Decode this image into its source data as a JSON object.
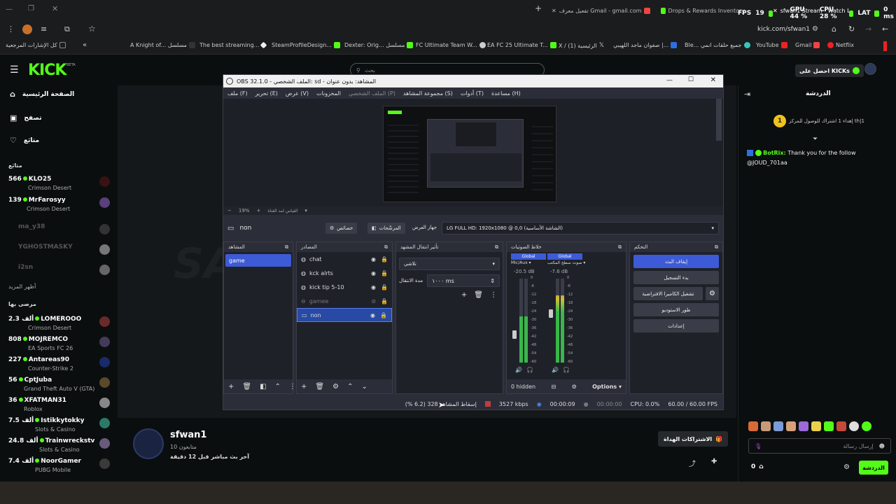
{
  "browser": {
    "tabs": [
      {
        "label": "تفعيل معرف Gmail - gmail.com"
      },
      {
        "label": "Drops & Rewards Inventory"
      },
      {
        "label": "sfwan1 Stream - Watch Live"
      }
    ],
    "overlay": {
      "fps_label": "FPS",
      "fps_value": "19",
      "gpu": "GPU 44 %",
      "cpu": "CPU 28 %",
      "lat": "LAT",
      "ms": "0 ms"
    },
    "url": "kick.com/sfwan1",
    "bookmarks": [
      {
        "label": "كل الإشارات المرجعية",
        "color": "#888"
      },
      {
        "label": "A Knight of... مسلسل",
        "color": "#333"
      },
      {
        "label": "The best streaming...",
        "color": "#fff"
      },
      {
        "label": "SteamProfileDesign...",
        "color": "#53fc18"
      },
      {
        "label": "Dexter: Orig... مسلسل",
        "color": "#53fc18"
      },
      {
        "label": "FC Ultimate Team W...",
        "color": "#ccc"
      },
      {
        "label": "EA FC 25 Ultimate T...",
        "color": "#53fc18"
      },
      {
        "label": "X / الرئيسية (1)",
        "color": "#fff"
      },
      {
        "label": "صفوان ماجد اللهيبي |...",
        "color": "#2d6fe0"
      },
      {
        "label": "Ble... جميع حلقات انمي",
        "color": "#39c5b8"
      },
      {
        "label": "YouTube",
        "color": "#e22"
      },
      {
        "label": "Gmail",
        "color": "#e44"
      },
      {
        "label": "Netflix",
        "color": "#e22"
      }
    ]
  },
  "kick": {
    "logo": "KICK",
    "beta": "BETA",
    "search_placeholder": "بحث",
    "get_kicks": "احصل على KICKs",
    "nav": [
      {
        "label": "الصفحة الرئيسية"
      },
      {
        "label": "تصفح"
      },
      {
        "label": "متابَع"
      }
    ],
    "following_heading": "متابَع",
    "following": [
      {
        "count": "566",
        "name": "KLO25",
        "game": "Crimson Desert",
        "live": true
      },
      {
        "count": "139",
        "name": "MrFarosyy",
        "game": "Crimson Desert",
        "live": true
      },
      {
        "count": "",
        "name": "ma_y38",
        "game": "",
        "live": false
      },
      {
        "count": "",
        "name": "YGHOSTMASKY",
        "game": "",
        "live": false
      },
      {
        "count": "",
        "name": "i2sn",
        "game": "",
        "live": false
      }
    ],
    "show_more": "أظهر المزيد",
    "recommended_heading": "مرصى بها",
    "recommended": [
      {
        "count": "2.3 ألف",
        "name": "LOMEROOO",
        "game": "Crimson Desert"
      },
      {
        "count": "808",
        "name": "MOJREMCO",
        "game": "EA Sports FC 26"
      },
      {
        "count": "227",
        "name": "Antareas90",
        "game": "Counter-Strike 2"
      },
      {
        "count": "56",
        "name": "CptJuba",
        "game": "Grand Theft Auto V (GTA)"
      },
      {
        "count": "36",
        "name": "XFATMAN31",
        "game": "Roblox"
      },
      {
        "count": "7.5 ألف",
        "name": "Istikkytokky",
        "game": "Slots & Casino"
      },
      {
        "count": "24.8 ألف",
        "name": "Trainwreckstv",
        "game": "Slots & Casino"
      },
      {
        "count": "7.4 ألف",
        "name": "NoorGamer",
        "game": "PUBG Mobile"
      }
    ],
    "streamer": {
      "name": "sfwan1",
      "followers": "10 متابعون",
      "last_live": "آخر بث مباشر قبل 12 دقيقة",
      "subscriptions": "الاشتراكات الهداة"
    },
    "chat": {
      "title": "الدردشة",
      "goal": "إهداء 1 اشتراك للوصول للمركز th|1",
      "goal_badge": "1",
      "bot": "BotRix:",
      "message": "Thank you for the follow @JOUD_701aa",
      "input_placeholder": "إرسال رسالة",
      "count": "0",
      "chat_button": "الدردشة"
    }
  },
  "obs": {
    "title": "OBS 32.1.0 - الملف الشخصي: sd - المشاهد: بدون عنوان",
    "menu": [
      "ملف (F)",
      "تحرير (E)",
      "عرض (V)",
      "المخزونات",
      "الملف الشخصي (P)",
      "مجموعة المشاهد (S)",
      "أدوات (T)",
      "مساعدة (H)"
    ],
    "zoom": "19%",
    "zoom_label": "القياس لمد القناة",
    "source_name": "non",
    "properties": "خصائص",
    "filters": "المرشّحات",
    "device_label": "جهاز العرض",
    "device_value": "LG FULL HD: 1920x1080 @ 0,0 (الشاشة الأساسية)",
    "docks": {
      "scenes": {
        "title": "المشاهد",
        "items": [
          "game"
        ]
      },
      "sources": {
        "title": "المصادر",
        "items": [
          "chat",
          "kck alrts",
          "kick tip 5-10",
          "gamee",
          "non"
        ]
      },
      "transitions": {
        "title": "تأثير انتقال المشهد",
        "type": "تلاشي",
        "duration_label": "مدة الانتقال",
        "duration": "١٠٠٠ ms"
      },
      "mixer": {
        "title": "خلاط الصوتيات",
        "channels": [
          {
            "tag": "Global",
            "name": "Mic/Aux",
            "db": "-20.5 dB",
            "level": 0.55
          },
          {
            "tag": "Global",
            "name": "صوت سطح المكتب",
            "db": "-7.6 dB",
            "level": 0.8
          }
        ],
        "ticks": [
          "0",
          "-6",
          "-12",
          "-18",
          "-24",
          "-30",
          "-36",
          "-42",
          "-48",
          "-54",
          "-60"
        ],
        "hidden": "0 hidden",
        "options": "Options"
      },
      "controls": {
        "title": "التحكم",
        "buttons": [
          "إيقاف البث",
          "بدء التسجيل",
          "تشغيل الكاميرا الافتراضية",
          "طور الاستوديو",
          "إعدادات"
        ]
      }
    },
    "status": {
      "dropped": "إسقاط المشاهد 328 (6.2 %)",
      "kbps": "3527 kbps",
      "stream_time": "00:00:09",
      "rec_time": "00:00:00",
      "cpu": "CPU: 0.0%",
      "fps": "60.00 / 60.00 FPS"
    }
  }
}
